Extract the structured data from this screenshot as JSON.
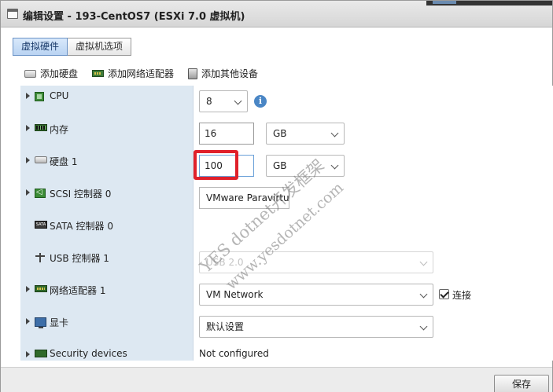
{
  "window": {
    "title": "编辑设置 - 193-CentOS7 (ESXi 7.0 虚拟机)"
  },
  "tabs": [
    {
      "label": "虚拟硬件",
      "active": true
    },
    {
      "label": "虚拟机选项",
      "active": false
    }
  ],
  "toolbar": {
    "add_disk": "添加硬盘",
    "add_nic": "添加网络适配器",
    "add_other": "添加其他设备"
  },
  "hardware": {
    "cpu": {
      "label": "CPU",
      "value": "8"
    },
    "memory": {
      "label": "内存",
      "value": "16",
      "unit": "GB"
    },
    "disk": {
      "label": "硬盘 1",
      "value": "100",
      "unit": "GB"
    },
    "scsi": {
      "label": "SCSI 控制器 0",
      "value": "VMware Paravirtual"
    },
    "sata": {
      "label": "SATA 控制器 0"
    },
    "usb": {
      "label": "USB 控制器 1",
      "value": "USB 2.0"
    },
    "network": {
      "label": "网络适配器 1",
      "value": "VM Network",
      "connect_label": "连接",
      "connected": true
    },
    "video": {
      "label": "显卡",
      "value": "默认设置"
    },
    "security": {
      "label": "Security devices",
      "value": "Not configured"
    }
  },
  "watermark": {
    "line1": "YES dotnet开发框架",
    "line2": "www.yesdotnet.com"
  },
  "footer": {
    "save_label": "保存"
  },
  "colors": {
    "label_bg": "#dde8f2",
    "accent": "#4a86c5",
    "highlight": "#e0202a"
  }
}
